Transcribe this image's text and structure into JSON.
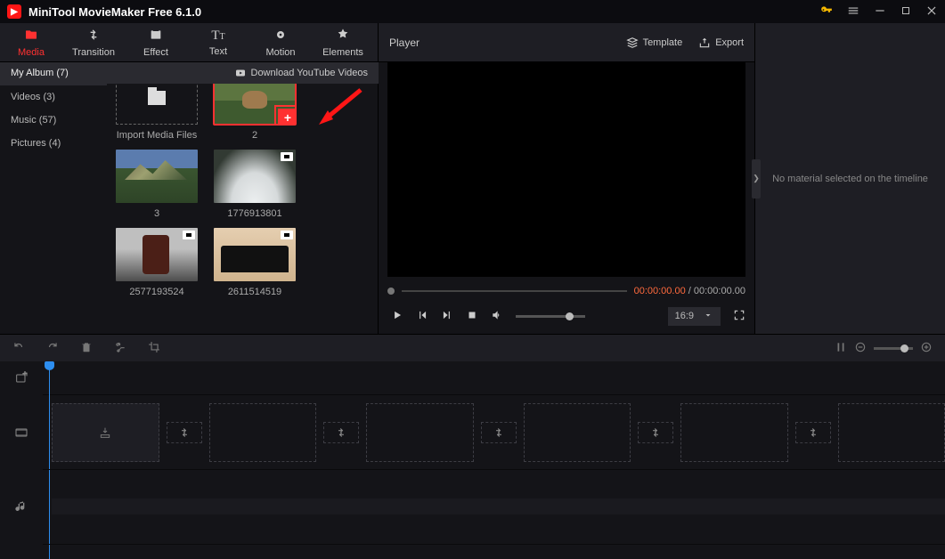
{
  "app": {
    "title": "MiniTool MovieMaker Free 6.1.0"
  },
  "main_tabs": [
    {
      "label": "Media",
      "active": true
    },
    {
      "label": "Transition"
    },
    {
      "label": "Effect"
    },
    {
      "label": "Text"
    },
    {
      "label": "Motion"
    },
    {
      "label": "Elements"
    }
  ],
  "download_link": "Download YouTube Videos",
  "library": {
    "categories": [
      {
        "label": "My Album (7)",
        "active": true
      },
      {
        "label": "Videos (3)"
      },
      {
        "label": "Music (57)"
      },
      {
        "label": "Pictures (4)"
      }
    ],
    "import_label": "Import Media Files",
    "items": [
      {
        "label": "2",
        "selected": true,
        "kind": "image"
      },
      {
        "label": "3",
        "kind": "image"
      },
      {
        "label": "1776913801",
        "kind": "video"
      },
      {
        "label": "2577193524",
        "kind": "video"
      },
      {
        "label": "2611514519",
        "kind": "video"
      }
    ]
  },
  "player": {
    "title": "Player",
    "template_label": "Template",
    "export_label": "Export",
    "time_current": "00:00:00.00",
    "time_sep": " / ",
    "time_total": "00:00:00.00",
    "aspect": "16:9"
  },
  "info_panel": {
    "empty_text": "No material selected on the timeline"
  }
}
